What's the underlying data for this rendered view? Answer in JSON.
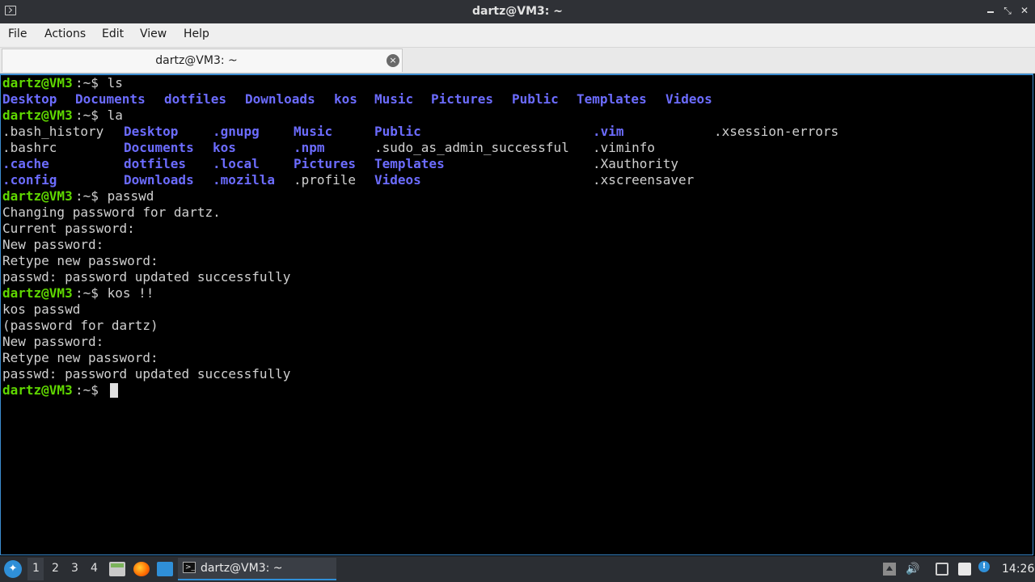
{
  "window": {
    "title": "dartz@VM3: ~",
    "minimize": "",
    "maximize": "⤡",
    "close": "✕"
  },
  "menubar": {
    "items": [
      "File",
      "Actions",
      "Edit",
      "View",
      "Help"
    ]
  },
  "tab": {
    "label": "dartz@VM3: ~",
    "close": "×"
  },
  "terminal": {
    "prompt_user": "dartz@VM3",
    "prompt_suffix": ":~$",
    "lines": [
      {
        "cmd": " ls"
      },
      {
        "out_ls": [
          "Desktop",
          "Documents",
          "dotfiles",
          "Downloads",
          "kos",
          "Music",
          "Pictures",
          "Public",
          "Templates",
          "Videos"
        ]
      },
      {
        "cmd": " la"
      },
      {
        "la_row1": [
          ".bash_history",
          "Desktop",
          ".gnupg",
          "Music",
          "Public",
          ".vim",
          ".xsession-errors"
        ]
      },
      {
        "la_row2": [
          ".bashrc",
          "Documents",
          "kos",
          ".npm",
          ".sudo_as_admin_successful",
          ".viminfo"
        ]
      },
      {
        "la_row3": [
          ".cache",
          "dotfiles",
          ".local",
          "Pictures",
          "Templates",
          ".Xauthority"
        ]
      },
      {
        "la_row4": [
          ".config",
          "Downloads",
          ".mozilla",
          ".profile",
          "Videos",
          ".xscreensaver"
        ]
      },
      {
        "cmd": " passwd"
      },
      {
        "text": "Changing password for dartz."
      },
      {
        "text": "Current password:"
      },
      {
        "text": "New password:"
      },
      {
        "text": "Retype new password:"
      },
      {
        "text": "passwd: password updated successfully"
      },
      {
        "cmd": " kos !!"
      },
      {
        "text": "kos passwd"
      },
      {
        "text": "(password for dartz)"
      },
      {
        "text": "New password:"
      },
      {
        "text": "Retype new password:"
      },
      {
        "text": "passwd: password updated successfully"
      },
      {
        "cmd": " "
      }
    ]
  },
  "taskbar": {
    "workspaces": [
      "1",
      "2",
      "3",
      "4"
    ],
    "active_workspace": "1",
    "window_task_label": "dartz@VM3: ~",
    "volume_icon": "🔊",
    "info_icon": "!",
    "clock": "14:26"
  },
  "colors": {
    "prompt": "#5fd700",
    "directory": "#6c6cff",
    "text": "#d0d0d0",
    "accent": "#2f8fd8"
  }
}
